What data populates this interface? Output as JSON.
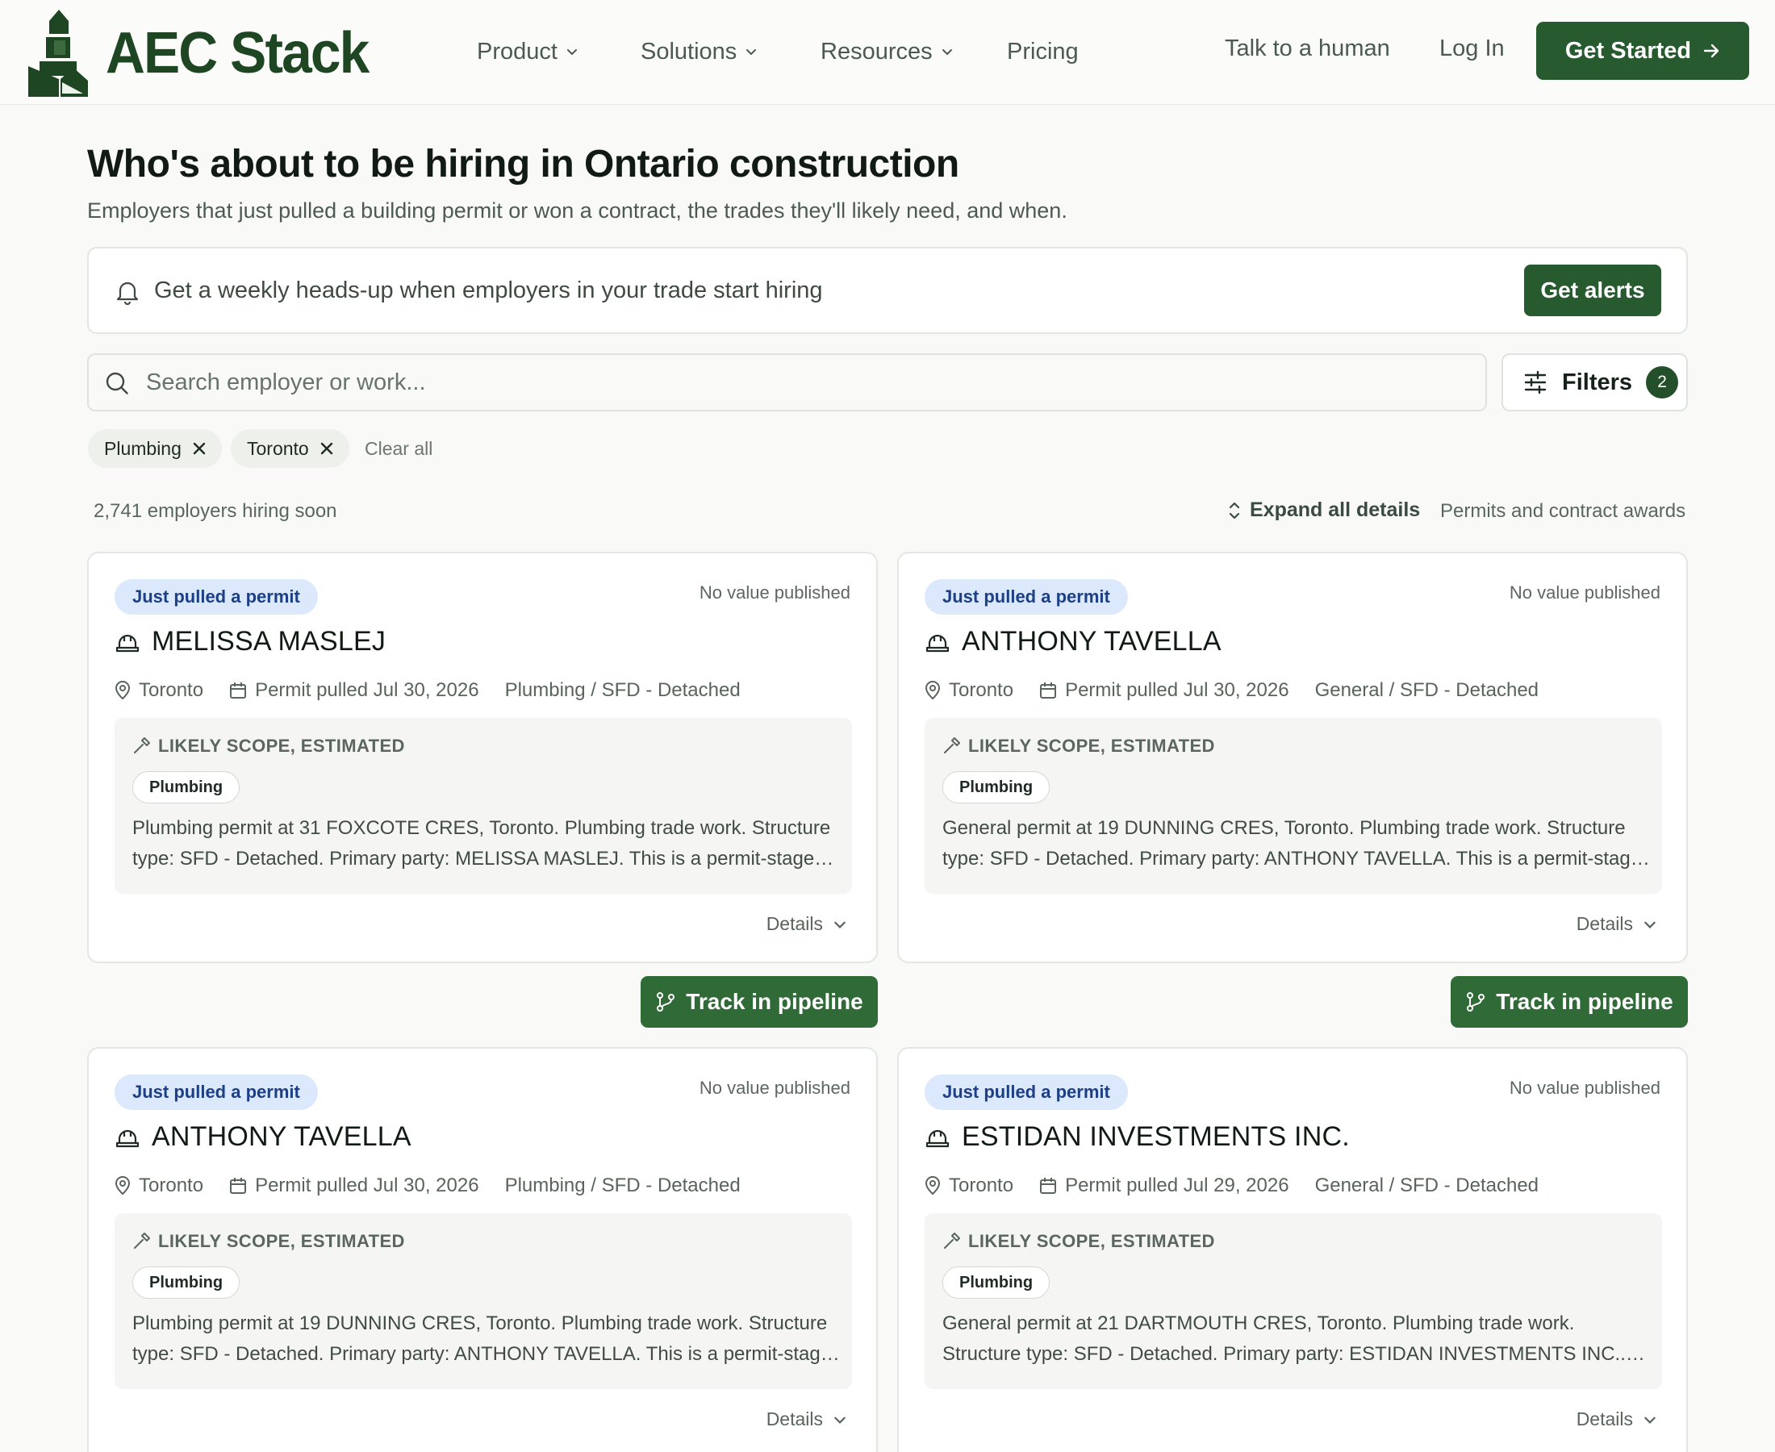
{
  "brand": {
    "name": "AEC Stack",
    "color": "#1e4622"
  },
  "nav": {
    "items": [
      {
        "label": "Product",
        "has_dropdown": true
      },
      {
        "label": "Solutions",
        "has_dropdown": true
      },
      {
        "label": "Resources",
        "has_dropdown": true
      },
      {
        "label": "Pricing",
        "has_dropdown": false
      }
    ],
    "talk": "Talk to a human",
    "login": "Log In",
    "cta": "Get Started"
  },
  "hero": {
    "title": "Who's about to be hiring in Ontario construction",
    "subtitle": "Employers that just pulled a building permit or won a contract, the trades they'll likely need, and when."
  },
  "alert": {
    "text": "Get a weekly heads-up when employers in your trade start hiring",
    "button": "Get alerts"
  },
  "search": {
    "placeholder": "Search employer or work...",
    "value": ""
  },
  "filters": {
    "label": "Filters",
    "count": "2",
    "chips": [
      "Plumbing",
      "Toronto"
    ],
    "clear": "Clear all"
  },
  "results": {
    "count_text": "2,741 employers hiring soon",
    "expand": "Expand all details",
    "source": "Permits and contract awards"
  },
  "cards": [
    {
      "badge": "Just pulled a permit",
      "value": "No value published",
      "name": "MELISSA MASLEJ",
      "location": "Toronto",
      "date": "Permit pulled Jul 30, 2026",
      "category": "Plumbing / SFD - Detached",
      "scope_label": "LIKELY SCOPE, ESTIMATED",
      "trade": "Plumbing",
      "description": "Plumbing permit at 31 FOXCOTE CRES, Toronto. Plumbing trade work. Structure type: SFD - Detached. Primary party: MELISSA MASLEJ. This is a permit-stage signal for upcoming hiring.",
      "details": "Details"
    },
    {
      "badge": "Just pulled a permit",
      "value": "No value published",
      "name": "ANTHONY TAVELLA",
      "location": "Toronto",
      "date": "Permit pulled Jul 30, 2026",
      "category": "General / SFD - Detached",
      "scope_label": "LIKELY SCOPE, ESTIMATED",
      "trade": "Plumbing",
      "description": "General permit at 19 DUNNING CRES, Toronto. Plumbing trade work. Structure type: SFD - Detached. Primary party: ANTHONY TAVELLA. This is a permit-stage signal for upcoming hiring.",
      "details": "Details"
    },
    {
      "badge": "Just pulled a permit",
      "value": "No value published",
      "name": "ANTHONY TAVELLA",
      "location": "Toronto",
      "date": "Permit pulled Jul 30, 2026",
      "category": "Plumbing / SFD - Detached",
      "scope_label": "LIKELY SCOPE, ESTIMATED",
      "trade": "Plumbing",
      "description": "Plumbing permit at 19 DUNNING CRES, Toronto. Plumbing trade work. Structure type: SFD - Detached. Primary party: ANTHONY TAVELLA. This is a permit-stage signal for upcoming hiring.",
      "details": "Details"
    },
    {
      "badge": "Just pulled a permit",
      "value": "No value published",
      "name": "ESTIDAN INVESTMENTS INC.",
      "location": "Toronto",
      "date": "Permit pulled Jul 29, 2026",
      "category": "General / SFD - Detached",
      "scope_label": "LIKELY SCOPE, ESTIMATED",
      "trade": "Plumbing",
      "description": "General permit at 21 DARTMOUTH CRES, Toronto. Plumbing trade work. Structure type: SFD - Detached. Primary party: ESTIDAN INVESTMENTS INC.. This is a permit-stage signal for upcoming hiring.",
      "details": "Details"
    }
  ],
  "track_label": "Track in pipeline",
  "colors": {
    "primary": "#275a2e",
    "badge_bg": "#dce8fb",
    "badge_text": "#1c3f85",
    "page_bg": "#f9faf8"
  }
}
